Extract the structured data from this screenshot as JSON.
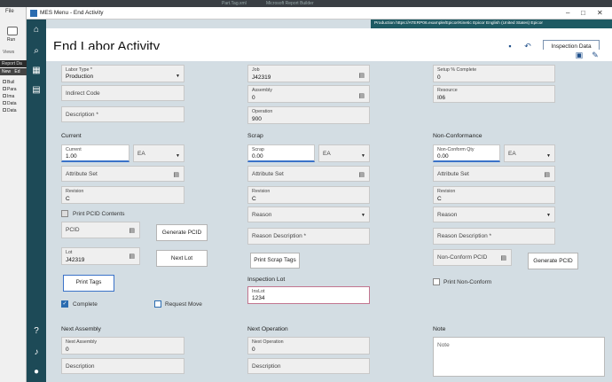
{
  "topbar": {
    "left": "Part.Tag.xml",
    "mid": "Microsoft Report Builder"
  },
  "bgapp": {
    "file": "File",
    "run": "Run",
    "views": "Views",
    "report_data": "Report Da",
    "tab_new": "New",
    "tab_edit": "Ed",
    "tree": [
      "Buil",
      "Para",
      "Ima",
      "Data",
      "Data"
    ]
  },
  "window": {
    "title": "MES Menu - End Activity"
  },
  "infobar": {
    "text": "Production   https://ATERP06.example/Epicor/Kinetic   Epicor   English (United States)   Epicor"
  },
  "header": {
    "page_title": "End Labor Activity",
    "inspection_button": "Inspection Data"
  },
  "col1": {
    "labor_type": {
      "label": "Labor Type *",
      "value": "Production"
    },
    "indirect_code": {
      "placeholder": "Indirect Code"
    },
    "description": {
      "placeholder": "Description *"
    },
    "current_title": "Current",
    "current": {
      "label": "Current",
      "value": "1.00"
    },
    "uom": {
      "value": "EA"
    },
    "attribute_set": {
      "placeholder": "Attribute Set"
    },
    "revision": {
      "label": "Revision",
      "value": "C"
    },
    "print_pcid": {
      "label": "Print PCID Contents"
    },
    "pcid": {
      "placeholder": "PCID"
    },
    "generate_pcid": "Generate PCID",
    "lot": {
      "label": "Lot",
      "value": "J42319"
    },
    "next_lot": "Next Lot",
    "print_tags": "Print Tags",
    "complete": {
      "label": "Complete",
      "checked": true
    },
    "request_move": {
      "label": "Request Move",
      "checked": false
    },
    "next_assembly_title": "Next Assembly",
    "next_assembly": {
      "label": "Next Assembly",
      "value": "0"
    },
    "next_description": {
      "placeholder": "Description"
    }
  },
  "col2": {
    "job": {
      "label": "Job",
      "value": "J42319"
    },
    "assembly": {
      "label": "Assembly",
      "value": "0"
    },
    "operation": {
      "label": "Operation",
      "value": "900"
    },
    "scrap_title": "Scrap",
    "scrap": {
      "label": "Scrap",
      "value": "0.00"
    },
    "uom": {
      "value": "EA"
    },
    "attribute_set": {
      "placeholder": "Attribute Set"
    },
    "revision": {
      "label": "Revision",
      "value": "C"
    },
    "reason": {
      "placeholder": "Reason"
    },
    "reason_description": {
      "placeholder": "Reason Description *"
    },
    "print_scrap_tags": "Print Scrap Tags",
    "inspection_lot_title": "Inspection Lot",
    "ins_lot": {
      "label": "InsLot",
      "value": "1234"
    },
    "next_operation_title": "Next Operation",
    "next_operation": {
      "label": "Next Operation",
      "value": "0"
    },
    "next_description": {
      "placeholder": "Description"
    }
  },
  "col3": {
    "setup_complete": {
      "label": "Setup % Complete",
      "value": "0"
    },
    "resource": {
      "label": "Resource",
      "value": "I06"
    },
    "nonconf_title": "Non-Conformance",
    "nonconf_qty": {
      "label": "Non-Conform Qty",
      "value": "0.00"
    },
    "uom": {
      "value": "EA"
    },
    "attribute_set": {
      "placeholder": "Attribute Set"
    },
    "revision": {
      "label": "Revision",
      "value": "C"
    },
    "reason": {
      "placeholder": "Reason"
    },
    "reason_description": {
      "placeholder": "Reason Description *"
    },
    "nonconform_pcid": {
      "placeholder": "Non-Conform PCID"
    },
    "generate_pcid": "Generate PCID",
    "print_nonconform": {
      "label": "Print Non-Conform",
      "checked": false
    },
    "note_title": "Note",
    "note": {
      "placeholder": "Note"
    }
  }
}
